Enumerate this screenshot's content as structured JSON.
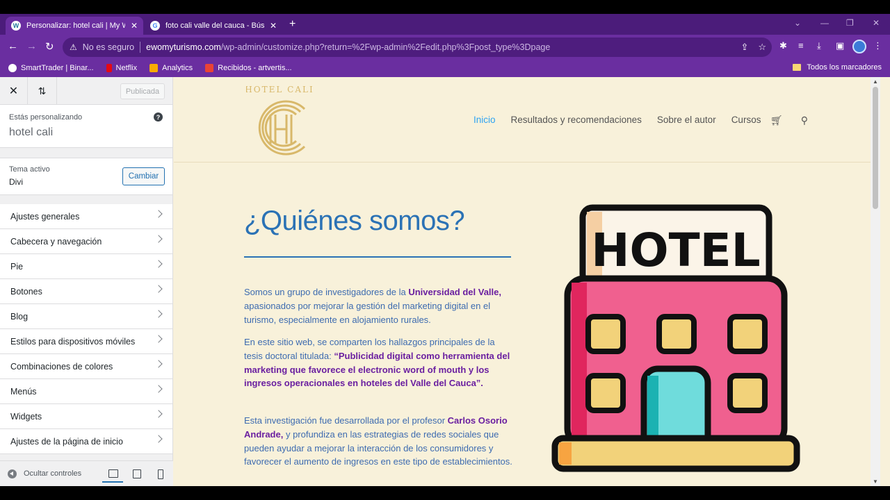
{
  "browser": {
    "tabs": [
      {
        "label": "Personalizar: hotel cali | My Wor…",
        "active": true
      },
      {
        "label": "foto cali valle del cauca - Búsqu…",
        "active": false
      }
    ],
    "new_tab": "+",
    "address": {
      "security": "No es seguro",
      "host": "ewomyturismo.com",
      "path": "/wp-admin/customize.php?return=%2Fwp-admin%2Fedit.php%3Fpost_type%3Dpage"
    },
    "bookmarks": [
      {
        "label": "SmartTrader | Binar...",
        "color": "#ffffff"
      },
      {
        "label": "Netflix",
        "color": "#e50914"
      },
      {
        "label": "Analytics",
        "color": "#f9ab00"
      },
      {
        "label": "Recibidos - artvertis...",
        "color": "#ea4335"
      }
    ],
    "all_bookmarks": "Todos los marcadores"
  },
  "customizer": {
    "published_button": "Publicada",
    "customizing_label": "Estás personalizando",
    "site_name": "hotel cali",
    "theme_label": "Tema activo",
    "theme_name": "Divi",
    "change_button": "Cambiar",
    "menu": [
      "Ajustes generales",
      "Cabecera y navegación",
      "Pie",
      "Botones",
      "Blog",
      "Estilos para dispositivos móviles",
      "Combinaciones de colores",
      "Menús",
      "Widgets",
      "Ajustes de la página de inicio"
    ],
    "hide_controls": "Ocultar controles"
  },
  "site": {
    "logo_text": "HOTEL CALI",
    "nav": [
      "Inicio",
      "Resultados y recomendaciones",
      "Sobre el autor",
      "Cursos"
    ],
    "heading": "¿Quiénes somos?",
    "hotel_sign": "HOTEL",
    "p1_a": "Somos un grupo de investigadores de la ",
    "p1_b": "Universidad del Valle,",
    "p1_c": " apasionados por mejorar la gestión del marketing digital en el turismo, especialmente en alojamiento rurales.",
    "p2_a": "En este sitio web, se comparten los hallazgos principales de la tesis doctoral titulada: ",
    "p2_b": "“Publicidad digital como herramienta del marketing que favorece el electronic word of mouth y los ingresos operacionales en hoteles del Valle del Cauca”.",
    "p3_a": "Esta investigación fue desarrollada por el profesor ",
    "p3_b": "Carlos Osorio Andrade,",
    "p3_c": " y profundiza en las estrategias de redes sociales que pueden ayudar a mejorar la interacción de los consumidores y favorecer el aumento de ingresos en este tipo de establecimientos."
  },
  "colors": {
    "browser_frame": "#6a2ea0",
    "page_bg": "#f8f1da",
    "heading": "#2b72b5",
    "highlight": "#6a1fa0",
    "nav_active": "#2ea3f2"
  }
}
